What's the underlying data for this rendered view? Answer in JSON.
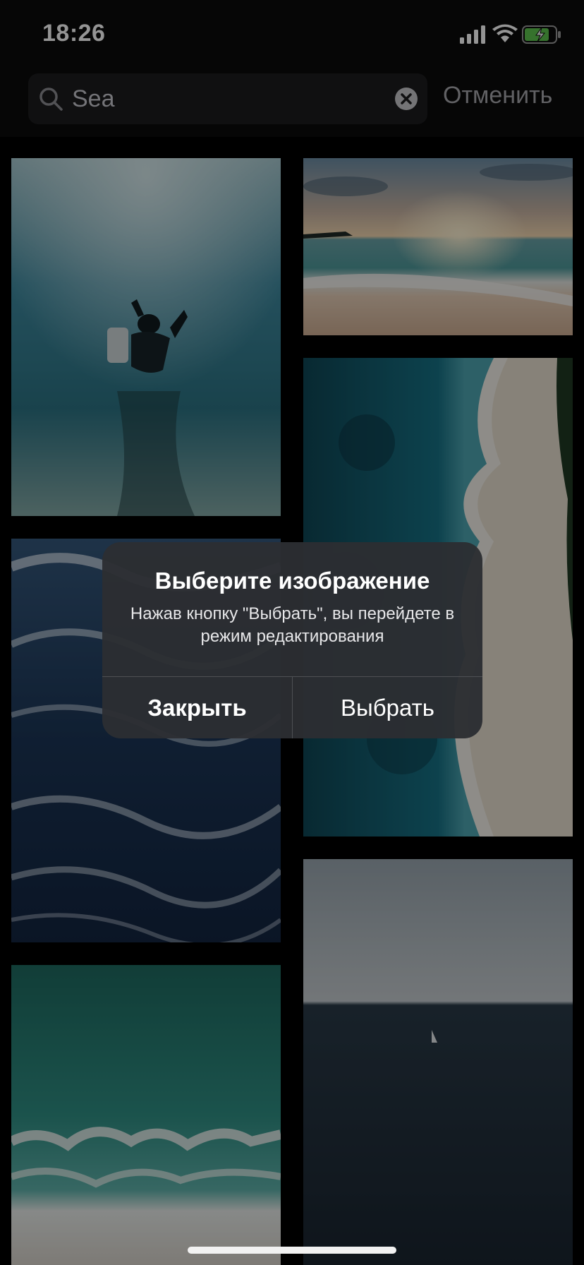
{
  "status_bar": {
    "time": "18:26",
    "signal_icon": "cellular-signal-icon",
    "wifi_icon": "wifi-icon",
    "battery_icon": "battery-charging-icon",
    "battery_color": "#5ec44e"
  },
  "search": {
    "icon": "search-icon",
    "value": "Sea",
    "clear_icon": "clear-icon",
    "cancel_label": "Отменить"
  },
  "photos": [
    {
      "name": "diver-underwater"
    },
    {
      "name": "beach-sunset"
    },
    {
      "name": "aerial-shoreline"
    },
    {
      "name": "ocean-waves"
    },
    {
      "name": "green-surf"
    },
    {
      "name": "calm-sea-sailboat"
    }
  ],
  "alert": {
    "title": "Выберите изображение",
    "message": "Нажав кнопку \"Выбрать\", вы перейдете в режим редактирования",
    "close_label": "Закрыть",
    "select_label": "Выбрать"
  }
}
